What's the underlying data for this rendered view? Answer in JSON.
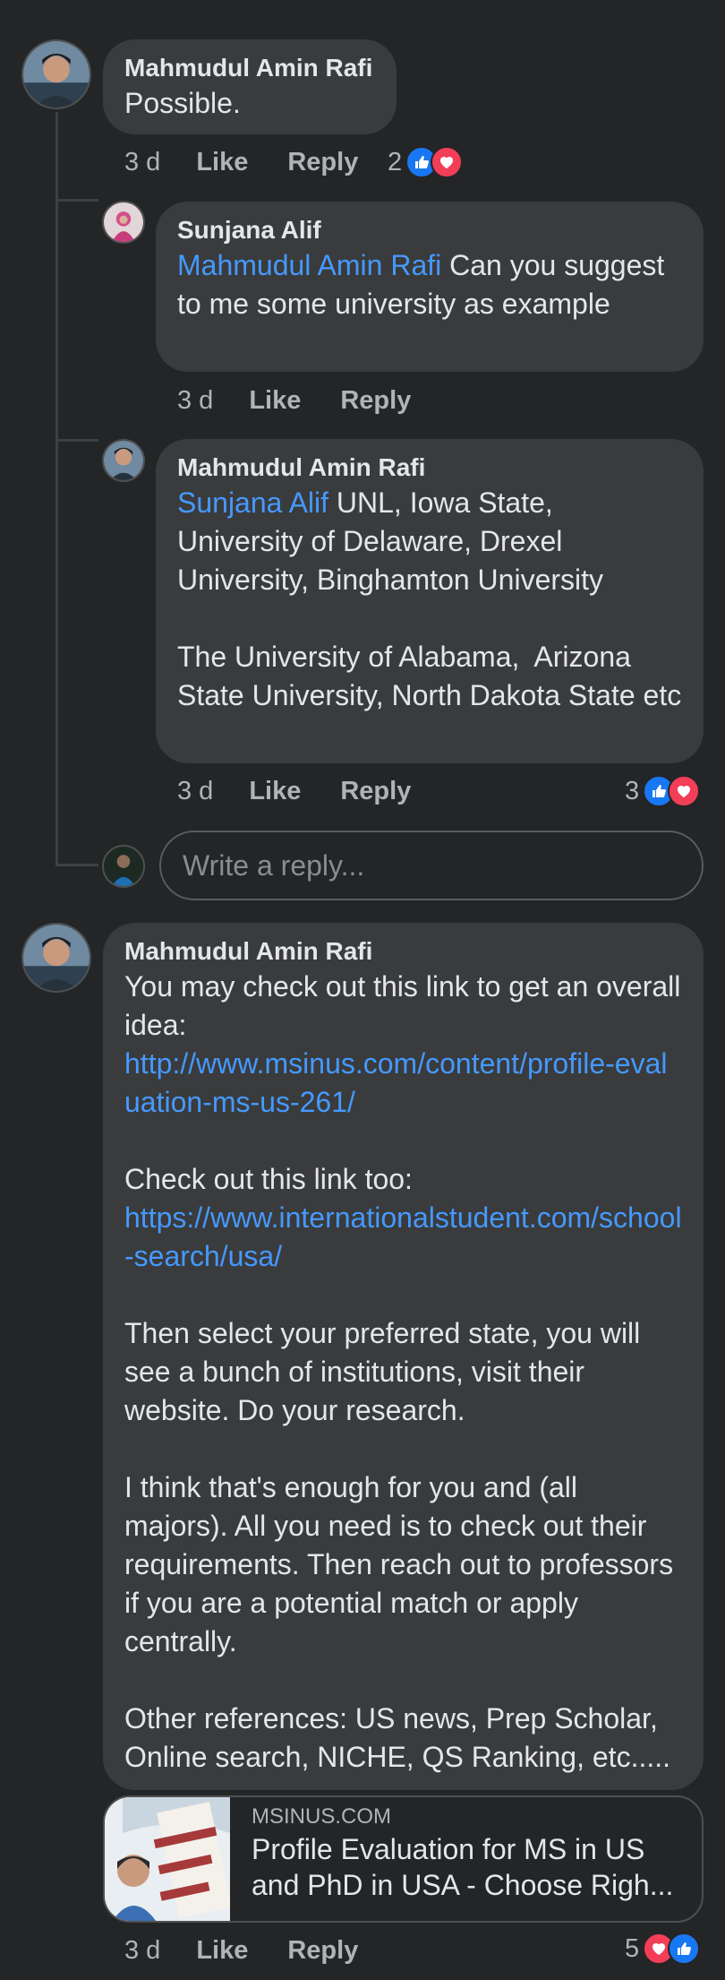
{
  "comments": [
    {
      "author": "Mahmudul Amin Rafi",
      "text": "Possible.",
      "time": "3 d",
      "like": "Like",
      "reply": "Reply",
      "reactions": "2"
    },
    {
      "author": "Sunjana Alif",
      "mention": "Mahmudul Amin Rafi",
      "text": " Can you suggest to me some university as example",
      "time": "3 d",
      "like": "Like",
      "reply": "Reply"
    },
    {
      "author": "Mahmudul Amin Rafi",
      "mention": "Sunjana Alif",
      "text": " UNL, Iowa State, University of Delaware, Drexel University, Binghamton University\n\nThe University of Alabama,  Arizona State University, North Dakota State etc",
      "time": "3 d",
      "like": "Like",
      "reply": "Reply",
      "reactions": "3"
    },
    {
      "author": "Mahmudul Amin Rafi",
      "text1": "You may check out this link to get an overall idea:",
      "link1": "http://www.msinus.com/content/profile-evaluation-ms-us-261/",
      "text2": "Check out this link too:",
      "link2": "https://www.internationalstudent.com/school-search/usa/",
      "text3": "Then select your preferred state, you will see a bunch of institutions, visit their website. Do your research.\n\nI think that's enough for you and (all majors). All you need is to check out their requirements. Then reach out to professors if you are a potential match or apply centrally.\n\nOther references: US news, Prep Scholar, Online search, NICHE, QS Ranking, etc.....",
      "time": "3 d",
      "like": "Like",
      "reply": "Reply",
      "reactions": "5"
    }
  ],
  "reply_input": {
    "placeholder": "Write a reply..."
  },
  "link_preview": {
    "domain": "MSINUS.COM",
    "title": "Profile Evaluation for MS in US and PhD in USA - Choose Righ..."
  },
  "colors": {
    "background": "#242526",
    "bubble": "#3a3b3c",
    "link": "#4599ff",
    "like_blue": "#1877f2",
    "love_red": "#f33e58"
  },
  "icons": [
    "avatar",
    "like-reaction-icon",
    "love-reaction-icon"
  ]
}
